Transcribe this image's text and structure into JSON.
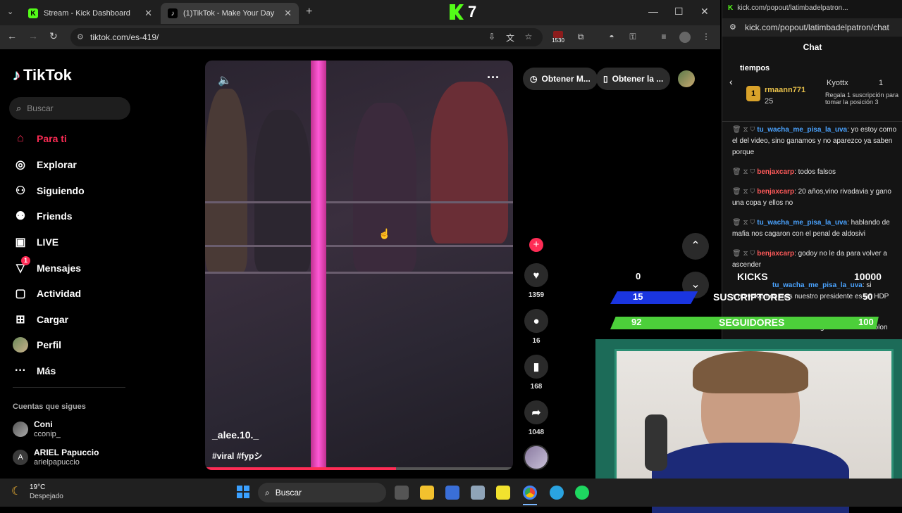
{
  "browser": {
    "tabs": [
      {
        "title": "Stream - Kick Dashboard",
        "favicon": "K"
      },
      {
        "title": "(1)TikTok - Make Your Day",
        "favicon": "♪"
      }
    ],
    "url": "tiktok.com/es-419/",
    "extension_badge": "1530",
    "overlay_logo": "7"
  },
  "tiktok": {
    "logo": "TikTok",
    "search_placeholder": "Buscar",
    "nav": [
      {
        "label": "Para ti",
        "icon": "home-icon",
        "active": true
      },
      {
        "label": "Explorar",
        "icon": "compass-icon"
      },
      {
        "label": "Siguiendo",
        "icon": "following-icon"
      },
      {
        "label": "Friends",
        "icon": "friends-icon"
      },
      {
        "label": "LIVE",
        "icon": "live-icon"
      },
      {
        "label": "Mensajes",
        "icon": "messages-icon",
        "badge": "1"
      },
      {
        "label": "Actividad",
        "icon": "activity-icon"
      },
      {
        "label": "Cargar",
        "icon": "upload-icon"
      },
      {
        "label": "Perfil",
        "icon": "avatar-icon"
      },
      {
        "label": "Más",
        "icon": "more-icon"
      }
    ],
    "following_header": "Cuentas que sigues",
    "following": [
      {
        "name": "Coni",
        "handle": "cconip_"
      },
      {
        "name": "ARIEL Papuccio",
        "handle": "arielpapuccio"
      }
    ],
    "video": {
      "author": "_alee.10._",
      "caption": "#viral #fypシ",
      "progress": 0.62
    },
    "actions": {
      "likes": "1359",
      "comments": "16",
      "saves": "168",
      "shares": "1048"
    },
    "top_pills": [
      "Obtener M...",
      "Obtener la ..."
    ]
  },
  "chat": {
    "title_url": "kick.com/popout/latimbadelpatron...",
    "url": "kick.com/popout/latimbadelpatron/chat",
    "header": "Chat",
    "pinned_label": "tiempos",
    "leaderboard": {
      "rank": "1",
      "user": "rmaann771",
      "count": "25",
      "gifter": "Kyottx",
      "gifter_count": "1",
      "gift_text": "Regala 1 suscripción para tomar la posición 3"
    },
    "messages": [
      {
        "user": "tu_wacha_me_pisa_la_uva",
        "text": ": yo estoy como el del video, sino ganamos y no aparezco ya saben porque",
        "color": "#4aa3ff"
      },
      {
        "user": "benjaxcarp",
        "text": ": todos falsos",
        "color": "#ff5a5a"
      },
      {
        "user": "benjaxcarp",
        "text": ": 20 años,vino rivadavia y gano una copa y ellos no",
        "color": "#ff5a5a"
      },
      {
        "user": "tu_wacha_me_pisa_la_uva",
        "text": ": hablando de mafia nos cagaron con el penal de aldosivi",
        "color": "#4aa3ff"
      },
      {
        "user": "benjaxcarp",
        "text": ": godoy no le da para volver a ascender",
        "color": "#ff5a5a"
      },
      {
        "user": "tu_wacha_me_pisa_la_uva",
        "text": ": si",
        "color": "#4aa3ff"
      },
      {
        "user": "",
        "text": "s no volvemos mas nuestro presidente es un HDP",
        "color": "#4aa3ff"
      },
      {
        "user": "",
        "text": "...ogaro nace la de colon",
        "color": "#ff5a5a"
      }
    ]
  },
  "overlay": {
    "kicks": {
      "label": "KICKS",
      "current": "0",
      "goal": "10000",
      "fraction": 0.0
    },
    "subs": {
      "label": "SUSCRIPTORES",
      "current": "15",
      "goal": "50",
      "fraction": 0.3
    },
    "followers": {
      "label": "SEGUIDORES",
      "current": "92",
      "goal": "100",
      "fraction": 0.92
    }
  },
  "taskbar": {
    "weather_temp": "19°C",
    "weather_desc": "Despejado",
    "search_placeholder": "Buscar"
  },
  "colors": {
    "accent": "#fe2c55",
    "kick_green": "#53fc18",
    "sub_blue": "#1a35e0",
    "follow_green": "#4ccf3a"
  }
}
